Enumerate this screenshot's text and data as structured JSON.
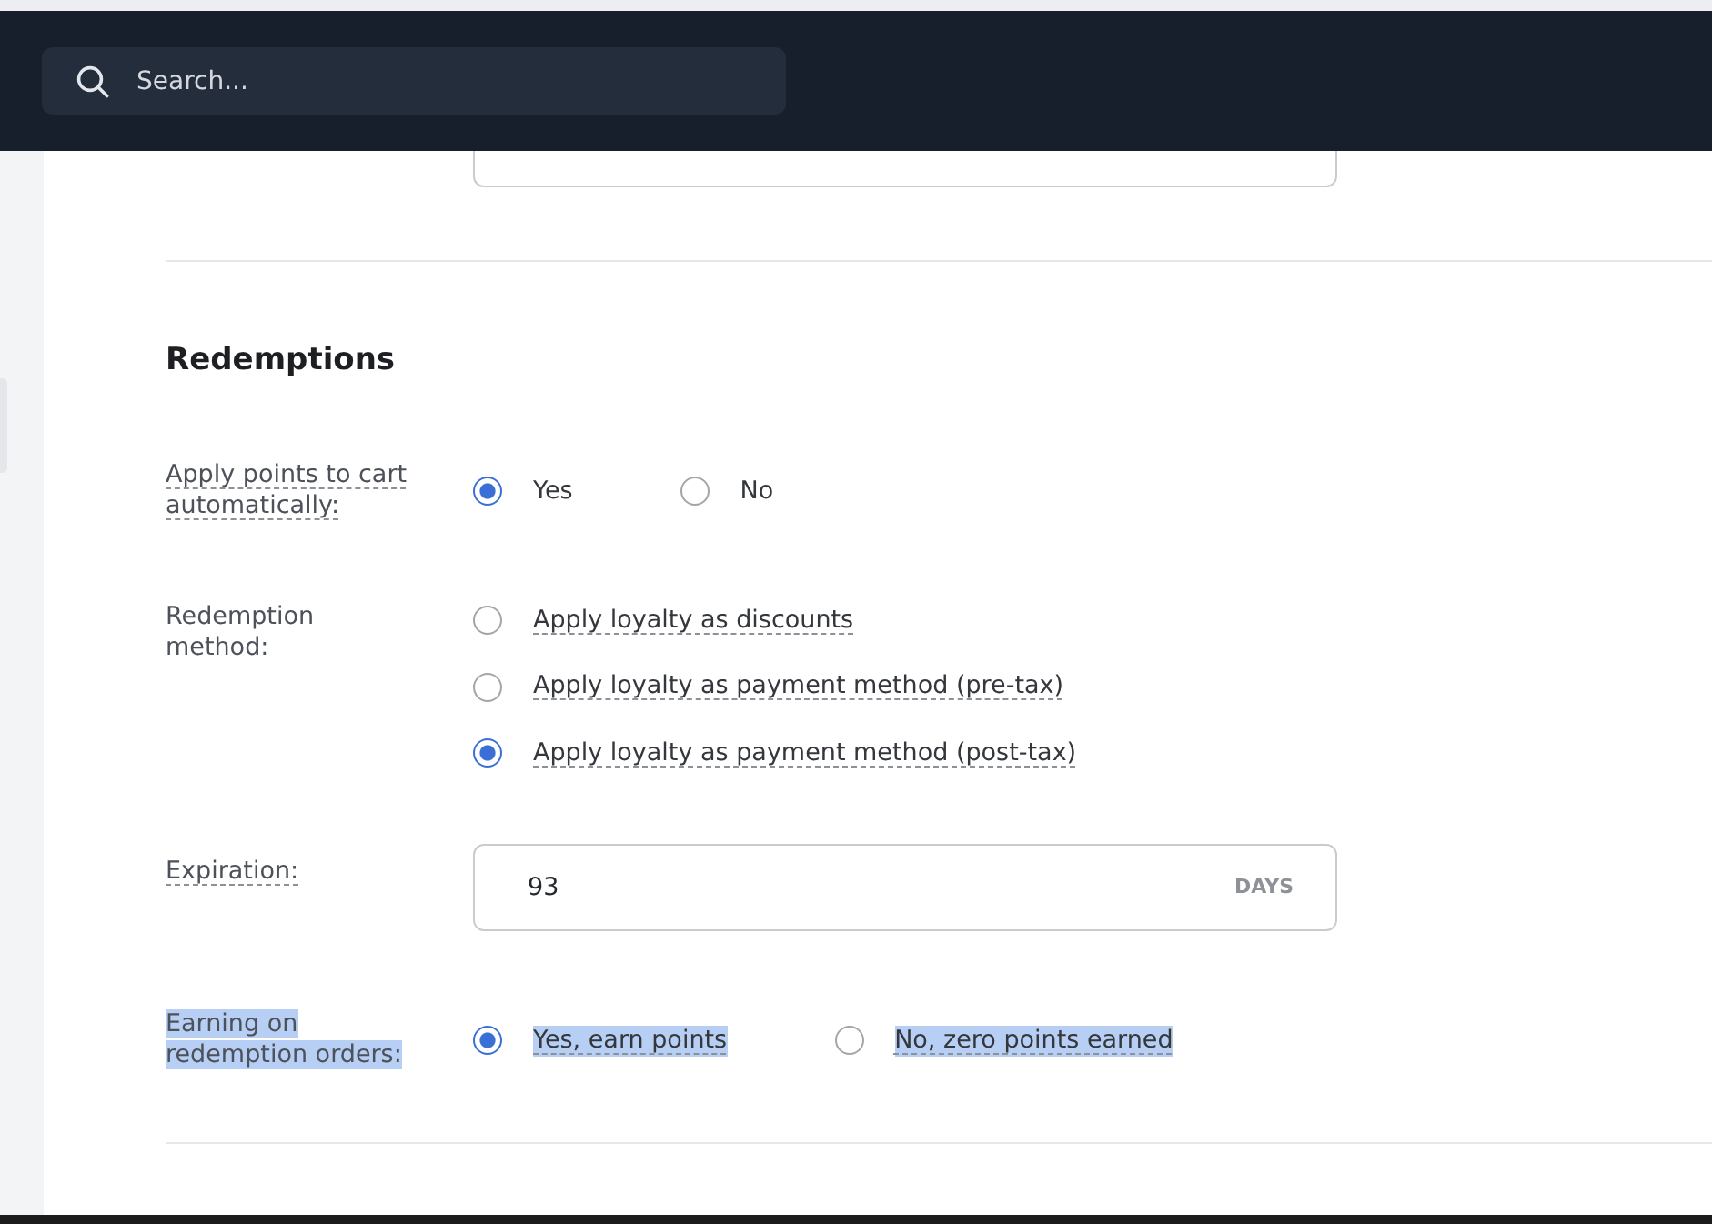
{
  "header": {
    "search": {
      "placeholder": "Search..."
    }
  },
  "section": {
    "title": "Redemptions",
    "fields": [
      {
        "kind": "radio_inline",
        "label": "Apply points to cart automatically:",
        "has_hint": true,
        "text_selected": false,
        "options": [
          {
            "label": "Yes",
            "has_hint": false,
            "selected": true
          },
          {
            "label": "No",
            "has_hint": false,
            "selected": false
          }
        ]
      },
      {
        "kind": "radio_stacked",
        "label": "Redemption method:",
        "has_hint": false,
        "text_selected": false,
        "options": [
          {
            "label": "Apply loyalty as discounts",
            "has_hint": true,
            "selected": false
          },
          {
            "label": "Apply loyalty as payment method (pre-tax)",
            "has_hint": true,
            "selected": false
          },
          {
            "label": "Apply loyalty as payment method (post-tax)",
            "has_hint": true,
            "selected": true
          }
        ]
      },
      {
        "kind": "number_unit",
        "label": "Expiration:",
        "has_hint": true,
        "text_selected": false,
        "value": "93",
        "unit": "DAYS"
      },
      {
        "kind": "radio_inline",
        "label": "Earning on redemption orders:",
        "has_hint": false,
        "text_selected": true,
        "options": [
          {
            "label": "Yes, earn points",
            "has_hint": true,
            "selected": true
          },
          {
            "label": "No, zero points earned",
            "has_hint": true,
            "selected": false
          }
        ]
      }
    ]
  }
}
